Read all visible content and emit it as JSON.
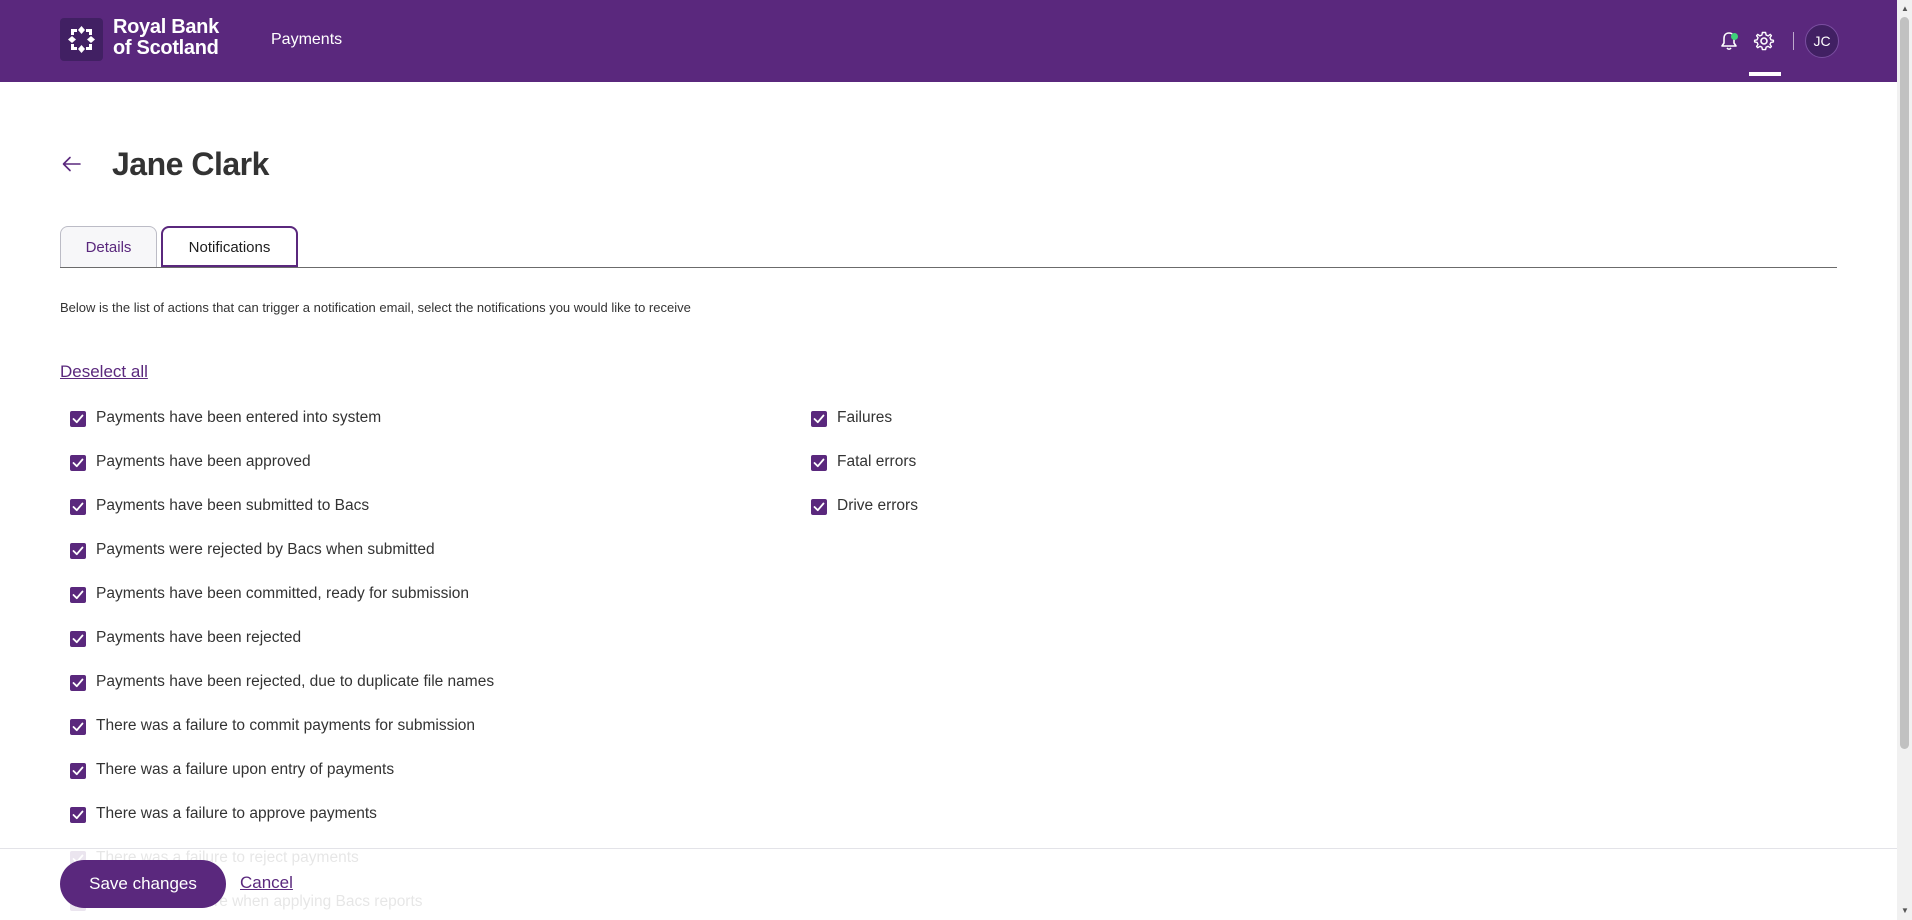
{
  "header": {
    "brand_line1": "Royal Bank",
    "brand_line2": "of Scotland",
    "nav_payments": "Payments",
    "avatar_initials": "JC",
    "notification_dot_color": "#3fd27a",
    "brand_color": "#5a287d"
  },
  "page": {
    "title": "Jane Clark"
  },
  "tabs": [
    {
      "label": "Details",
      "active": false
    },
    {
      "label": "Notifications",
      "active": true
    }
  ],
  "notifications": {
    "intro": "Below is the list of actions that can trigger a notification email, select the notifications you would like to receive",
    "deselect_all": "Deselect all",
    "left_items": [
      {
        "label": "Payments have been entered into system",
        "checked": true
      },
      {
        "label": "Payments have been approved",
        "checked": true
      },
      {
        "label": "Payments have been submitted to Bacs",
        "checked": true
      },
      {
        "label": "Payments were rejected by Bacs when submitted",
        "checked": true
      },
      {
        "label": "Payments have been committed, ready for submission",
        "checked": true
      },
      {
        "label": "Payments have been rejected",
        "checked": true
      },
      {
        "label": "Payments have been rejected, due to duplicate file names",
        "checked": true
      },
      {
        "label": "There was a failure to commit payments for submission",
        "checked": true
      },
      {
        "label": "There was a failure upon entry of payments",
        "checked": true
      },
      {
        "label": "There was a failure to approve payments",
        "checked": true
      },
      {
        "label": "There was a failure to reject payments",
        "checked": true
      },
      {
        "label": "There was a failure when applying Bacs reports",
        "checked": true
      }
    ],
    "right_items": [
      {
        "label": "Failures",
        "checked": true
      },
      {
        "label": "Fatal errors",
        "checked": true
      },
      {
        "label": "Drive errors",
        "checked": true
      }
    ]
  },
  "footer": {
    "save_label": "Save changes",
    "cancel_label": "Cancel"
  }
}
